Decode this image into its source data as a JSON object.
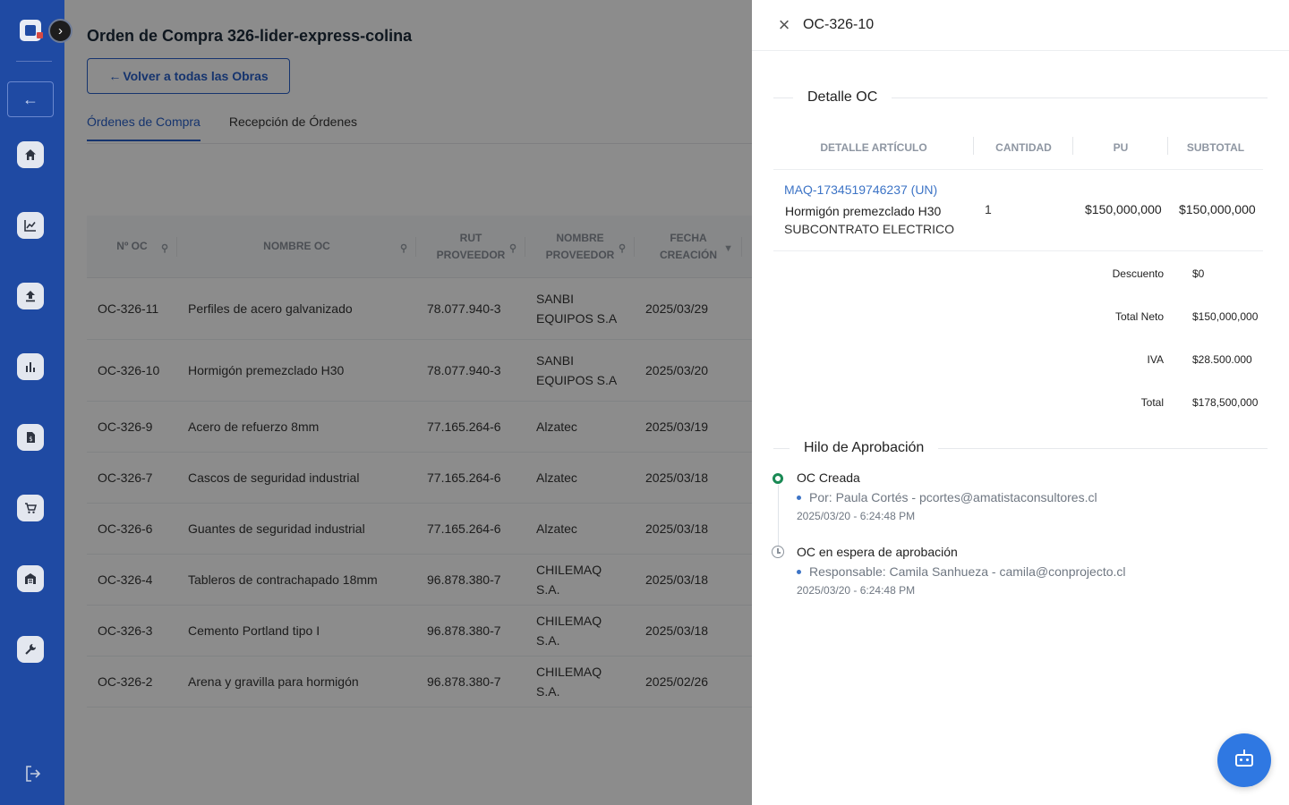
{
  "page": {
    "title": "Orden de Compra 326-lider-express-colina",
    "back_button": "Volver a todas las Obras",
    "back_arrow": "←",
    "tabs": [
      "Órdenes de Compra",
      "Recepción de Órdenes"
    ]
  },
  "sidebar": {
    "items": [
      "home-icon",
      "chart-line-icon",
      "upload-icon",
      "bar-chart-icon",
      "invoice-icon",
      "cart-icon",
      "warehouse-icon",
      "wrench-icon"
    ],
    "expand_glyph": "›",
    "back_glyph": "←",
    "logout_glyph": "⇥"
  },
  "table": {
    "headers": [
      "Nº OC",
      "NOMBRE OC",
      "RUT PROVEEDOR",
      "NOMBRE PROVEEDOR",
      "FECHA CREACIÓN"
    ],
    "rows": [
      [
        "OC-326-11",
        "Perfiles de acero galvanizado",
        "78.077.940-3",
        "SANBI EQUIPOS S.A",
        "2025/03/29"
      ],
      [
        "OC-326-10",
        "Hormigón premezclado H30",
        "78.077.940-3",
        "SANBI EQUIPOS S.A",
        "2025/03/20"
      ],
      [
        "OC-326-9",
        "Acero de refuerzo 8mm",
        "77.165.264-6",
        "Alzatec",
        "2025/03/19"
      ],
      [
        "OC-326-7",
        "Cascos de seguridad industrial",
        "77.165.264-6",
        "Alzatec",
        "2025/03/18"
      ],
      [
        "OC-326-6",
        "Guantes de seguridad industrial",
        "77.165.264-6",
        "Alzatec",
        "2025/03/18"
      ],
      [
        "OC-326-4",
        "Tableros de contrachapado 18mm",
        "96.878.380-7",
        "CHILEMAQ S.A.",
        "2025/03/18"
      ],
      [
        "OC-326-3",
        "Cemento Portland tipo I",
        "96.878.380-7",
        "CHILEMAQ S.A.",
        "2025/03/18"
      ],
      [
        "OC-326-2",
        "Arena y gravilla para hormigón",
        "96.878.380-7",
        "CHILEMAQ S.A.",
        "2025/02/26"
      ]
    ]
  },
  "drawer": {
    "title": "OC-326-10",
    "close_glyph": "×",
    "detail_section": "Detalle OC",
    "columns": [
      "DETALLE ARTÍCULO",
      "CANTIDAD",
      "PU",
      "SUBTOTAL"
    ],
    "item": {
      "code": "MAQ-1734519746237 (UN)",
      "description": "Hormigón premezclado H30",
      "category": "SUBCONTRATO ELECTRICO",
      "quantity": "1",
      "pu": "$150,000,000",
      "subtotal": "$150,000,000"
    },
    "totals": [
      {
        "label": "Descuento",
        "value": "$0"
      },
      {
        "label": "Total Neto",
        "value": "$150,000,000"
      },
      {
        "label": "IVA",
        "value": "$28.500.000"
      },
      {
        "label": "Total",
        "value": "$178,500,000"
      }
    ],
    "approval_section": "Hilo de Aprobación",
    "timeline": [
      {
        "title": "OC Creada",
        "detail": "Por: Paula Cortés - pcortes@amatistaconsultores.cl",
        "date": "2025/03/20 - 6:24:48 PM",
        "status_color": "#1a8a55"
      },
      {
        "title": "OC en espera de aprobación",
        "detail": "Responsable: Camila Sanhueza - camila@conprojecto.cl",
        "date": "2025/03/20 - 6:24:48 PM",
        "status_color": "#8c939c"
      }
    ]
  },
  "colors": {
    "sidebar": "#1f4aa3",
    "accent": "#2860c8",
    "bot_button": "#2f78e2"
  }
}
